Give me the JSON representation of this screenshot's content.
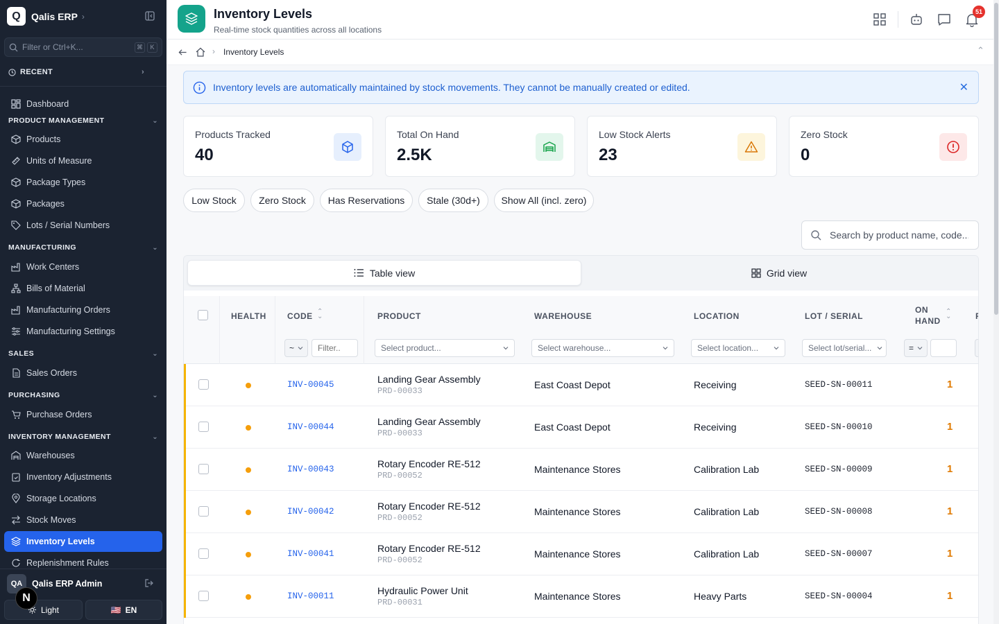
{
  "brand": {
    "logo_letter": "Q",
    "name": "Qalis ERP"
  },
  "sidebar": {
    "search_placeholder": "Filter or Ctrl+K...",
    "kbd1": "⌘",
    "kbd2": "K",
    "recent_label": "RECENT",
    "dashboard": "Dashboard",
    "sections": {
      "product": "PRODUCT MANAGEMENT",
      "manufacturing": "MANUFACTURING",
      "sales": "SALES",
      "purchasing": "PURCHASING",
      "inventory": "INVENTORY MANAGEMENT"
    },
    "items": {
      "products": "Products",
      "uom": "Units of Measure",
      "package_types": "Package Types",
      "packages": "Packages",
      "lots": "Lots / Serial Numbers",
      "work_centers": "Work Centers",
      "bom": "Bills of Material",
      "mo": "Manufacturing Orders",
      "mfg_settings": "Manufacturing Settings",
      "sales_orders": "Sales Orders",
      "purchase_orders": "Purchase Orders",
      "warehouses": "Warehouses",
      "inv_adj": "Inventory Adjustments",
      "storage_locations": "Storage Locations",
      "stock_moves": "Stock Moves",
      "inventory_levels": "Inventory Levels",
      "replenishment": "Replenishment Rules"
    },
    "user_initials": "QA",
    "user_name": "Qalis ERP Admin",
    "n_badge": "N",
    "theme_label": "Light",
    "lang_flag": "🇺🇸",
    "lang_label": "EN"
  },
  "header": {
    "title": "Inventory Levels",
    "subtitle": "Real-time stock quantities across all locations",
    "notif_count": "51"
  },
  "breadcrumb": {
    "current": "Inventory Levels"
  },
  "info_banner": "Inventory levels are automatically maintained by stock movements. They cannot be manually created or edited.",
  "stats": [
    {
      "label": "Products Tracked",
      "value": "40"
    },
    {
      "label": "Total On Hand",
      "value": "2.5K"
    },
    {
      "label": "Low Stock Alerts",
      "value": "23"
    },
    {
      "label": "Zero Stock",
      "value": "0"
    }
  ],
  "filters": [
    "Low Stock",
    "Zero Stock",
    "Has Reservations",
    "Stale (30d+)",
    "Show All (incl. zero)"
  ],
  "search_placeholder": "Search by product name, code...",
  "view_tabs": {
    "table": "Table view",
    "grid": "Grid view"
  },
  "columns": {
    "health": "HEALTH",
    "code": "CODE",
    "product": "PRODUCT",
    "warehouse": "WAREHOUSE",
    "location": "LOCATION",
    "lot": "LOT / SERIAL",
    "on_hand_1": "ON",
    "on_hand_2": "HAND",
    "next": "R"
  },
  "column_filters": {
    "code_op": "~",
    "code_placeholder": "Filter..",
    "product": "Select product...",
    "warehouse": "Select warehouse...",
    "location": "Select location...",
    "lot": "Select lot/serial...",
    "qty_op": "="
  },
  "rows": [
    {
      "code": "INV-00045",
      "product": "Landing Gear Assembly",
      "product_code": "PRD-00033",
      "warehouse": "East Coast Depot",
      "location": "Receiving",
      "lot": "SEED-SN-00011",
      "on_hand": "1"
    },
    {
      "code": "INV-00044",
      "product": "Landing Gear Assembly",
      "product_code": "PRD-00033",
      "warehouse": "East Coast Depot",
      "location": "Receiving",
      "lot": "SEED-SN-00010",
      "on_hand": "1"
    },
    {
      "code": "INV-00043",
      "product": "Rotary Encoder RE-512",
      "product_code": "PRD-00052",
      "warehouse": "Maintenance Stores",
      "location": "Calibration Lab",
      "lot": "SEED-SN-00009",
      "on_hand": "1"
    },
    {
      "code": "INV-00042",
      "product": "Rotary Encoder RE-512",
      "product_code": "PRD-00052",
      "warehouse": "Maintenance Stores",
      "location": "Calibration Lab",
      "lot": "SEED-SN-00008",
      "on_hand": "1"
    },
    {
      "code": "INV-00041",
      "product": "Rotary Encoder RE-512",
      "product_code": "PRD-00052",
      "warehouse": "Maintenance Stores",
      "location": "Calibration Lab",
      "lot": "SEED-SN-00007",
      "on_hand": "1"
    },
    {
      "code": "INV-00011",
      "product": "Hydraulic Power Unit",
      "product_code": "PRD-00031",
      "warehouse": "Maintenance Stores",
      "location": "Heavy Parts",
      "lot": "SEED-SN-00004",
      "on_hand": "1"
    }
  ],
  "colors": {
    "accent": "#2563eb",
    "brand": "#14a38b",
    "sidebar": "#1b2331",
    "low_stock": "#f59e0b",
    "danger": "#e5322d"
  }
}
